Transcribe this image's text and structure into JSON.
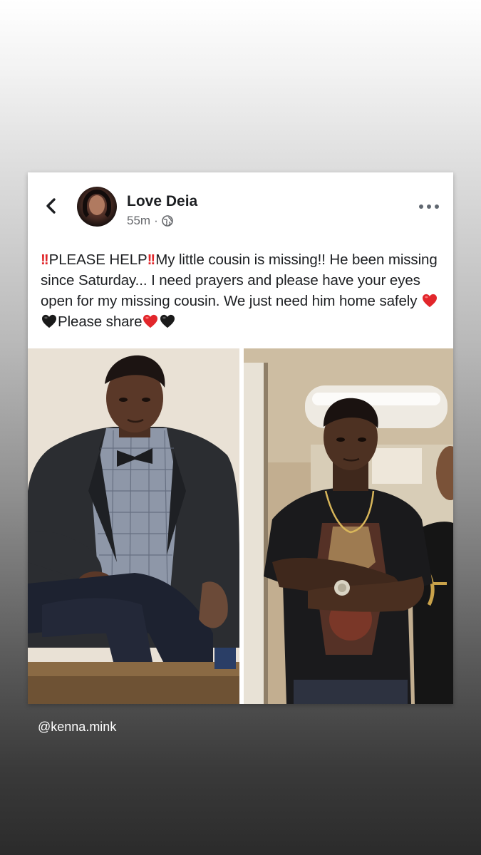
{
  "post": {
    "author_name": "Love Deia",
    "time_label": "55m",
    "time_separator": "·",
    "privacy_icon": "globe-icon",
    "text_alert_prefix": "!!",
    "text_line1": "PLEASE HELP",
    "text_alert_mid": "!!",
    "text_part2": "My little cousin is missing!! He been missing since Saturday... I need prayers and please have your eyes open for my missing cousin. We just need him home safely",
    "text_part3": "Please share",
    "emojis": [
      "red-heart",
      "black-heart",
      "red-heart",
      "black-heart"
    ]
  },
  "icons": {
    "back": "chevron-left-icon",
    "more": "more-options-icon"
  },
  "photos": [
    {
      "description_name": "photo-young-man-suit-bowtie"
    },
    {
      "description_name": "photo-young-man-black-tshirt"
    }
  ],
  "story": {
    "mention": "@kenna.mink"
  },
  "colors": {
    "alert_red": "#e0262a",
    "heart_red": "#e2262b",
    "heart_black": "#1a1a1a",
    "text_primary": "#1c1e21",
    "text_secondary": "#65676b"
  }
}
